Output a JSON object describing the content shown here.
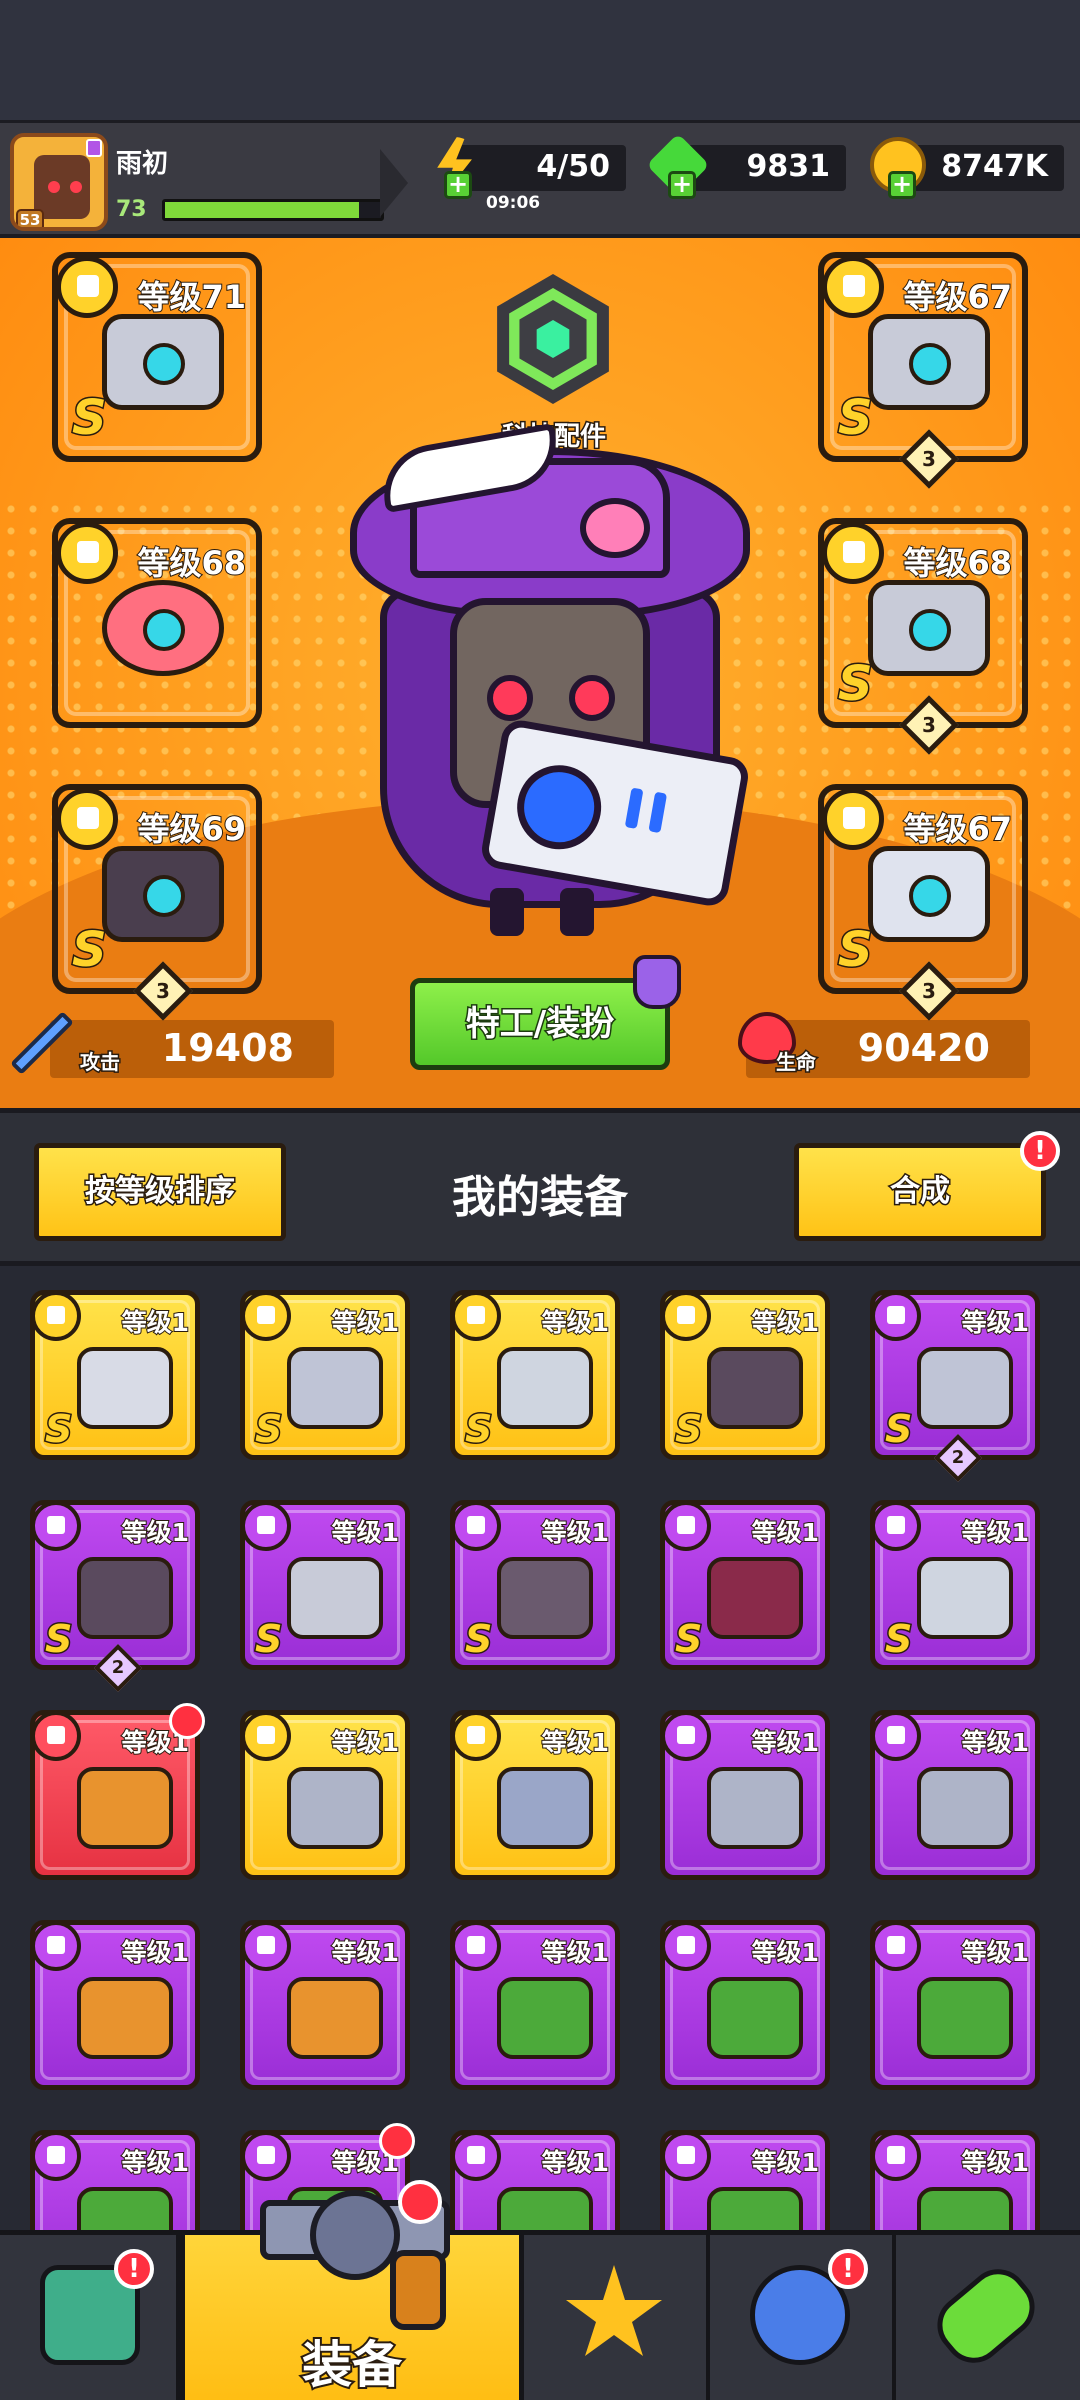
{
  "player": {
    "name": "雨初",
    "level": "73",
    "avatar_level": "53",
    "xp_fraction": 0.9
  },
  "resources": {
    "energy": {
      "value": "4/50",
      "timer": "09:06",
      "icon": "lightning-icon",
      "color": "#ffc21f"
    },
    "gems": {
      "value": "9831",
      "icon": "green-gem-icon",
      "color": "#46d93a"
    },
    "coins": {
      "value": "8747K",
      "icon": "gold-coin-icon",
      "color": "#ffc21f"
    }
  },
  "hero": {
    "tech_part_label": "科技配件",
    "agent_button": "特工/装扮",
    "attack": {
      "label": "攻击",
      "value": "19408"
    },
    "health": {
      "label": "生命",
      "value": "90420"
    },
    "equipped": [
      {
        "slot": "weapon",
        "level": "等级71",
        "grade": "S",
        "rarity": "gold",
        "stars": ""
      },
      {
        "slot": "necklace",
        "level": "等级68",
        "grade": "",
        "rarity": "red",
        "stars": ""
      },
      {
        "slot": "gloves",
        "level": "等级69",
        "grade": "S",
        "rarity": "gold",
        "stars": "3"
      },
      {
        "slot": "armor",
        "level": "等级67",
        "grade": "S",
        "rarity": "gold",
        "stars": "3"
      },
      {
        "slot": "belt",
        "level": "等级68",
        "grade": "S",
        "rarity": "gold",
        "stars": "3"
      },
      {
        "slot": "boots",
        "level": "等级67",
        "grade": "S",
        "rarity": "gold",
        "stars": "3"
      }
    ]
  },
  "toolbar": {
    "sort_button": "按等级排序",
    "title": "我的装备",
    "merge_button": "合成",
    "merge_alert": "!"
  },
  "inventory": [
    {
      "level": "等级1",
      "grade": "S",
      "rarity": "gold",
      "stars": "",
      "art": "#d8dbe6"
    },
    {
      "level": "等级1",
      "grade": "S",
      "rarity": "gold",
      "stars": "",
      "art": "#bfc4d6"
    },
    {
      "level": "等级1",
      "grade": "S",
      "rarity": "gold",
      "stars": "",
      "art": "#cfd5e0"
    },
    {
      "level": "等级1",
      "grade": "S",
      "rarity": "gold",
      "stars": "",
      "art": "#5a4a5e"
    },
    {
      "level": "等级1",
      "grade": "S",
      "rarity": "purple",
      "stars": "2",
      "art": "#bfc4d6"
    },
    {
      "level": "等级1",
      "grade": "S",
      "rarity": "purple",
      "stars": "2",
      "art": "#5a4a5e"
    },
    {
      "level": "等级1",
      "grade": "S",
      "rarity": "purple",
      "stars": "",
      "art": "#c8cbd8"
    },
    {
      "level": "等级1",
      "grade": "S",
      "rarity": "purple",
      "stars": "",
      "art": "#6a5a6e"
    },
    {
      "level": "等级1",
      "grade": "S",
      "rarity": "purple",
      "stars": "",
      "art": "#8a2a4a"
    },
    {
      "level": "等级1",
      "grade": "S",
      "rarity": "purple",
      "stars": "",
      "art": "#cfd5e0"
    },
    {
      "level": "等级1",
      "grade": "",
      "rarity": "red",
      "stars": "",
      "art": "#e8932e",
      "badge": true
    },
    {
      "level": "等级1",
      "grade": "",
      "rarity": "gold",
      "stars": "",
      "art": "#aeb4c8"
    },
    {
      "level": "等级1",
      "grade": "",
      "rarity": "gold",
      "stars": "",
      "art": "#9aa6c8"
    },
    {
      "level": "等级1",
      "grade": "",
      "rarity": "purple",
      "stars": "",
      "art": "#aeb4c8"
    },
    {
      "level": "等级1",
      "grade": "",
      "rarity": "purple",
      "stars": "",
      "art": "#aeb4c8"
    },
    {
      "level": "等级1",
      "grade": "",
      "rarity": "purple",
      "stars": "",
      "art": "#e8932e"
    },
    {
      "level": "等级1",
      "grade": "",
      "rarity": "purple",
      "stars": "",
      "art": "#e8932e"
    },
    {
      "level": "等级1",
      "grade": "",
      "rarity": "purple",
      "stars": "",
      "art": "#4caa3a"
    },
    {
      "level": "等级1",
      "grade": "",
      "rarity": "purple",
      "stars": "",
      "art": "#4caa3a"
    },
    {
      "level": "等级1",
      "grade": "",
      "rarity": "purple",
      "stars": "",
      "art": "#4caa3a"
    },
    {
      "level": "等级1",
      "grade": "",
      "rarity": "purple",
      "stars": "",
      "art": "#4caa3a"
    },
    {
      "level": "等级1",
      "grade": "",
      "rarity": "purple",
      "stars": "",
      "art": "#4caa3a",
      "badge": true
    },
    {
      "level": "等级1",
      "grade": "",
      "rarity": "purple",
      "stars": "",
      "art": "#4caa3a"
    },
    {
      "level": "等级1",
      "grade": "",
      "rarity": "purple",
      "stars": "",
      "art": "#4caa3a"
    },
    {
      "level": "等级1",
      "grade": "",
      "rarity": "purple",
      "stars": "",
      "art": "#4caa3a"
    }
  ],
  "nav": {
    "tabs": [
      {
        "name": "shop",
        "icon": "shop-stall-icon",
        "label": "",
        "alert": "!"
      },
      {
        "name": "equipment",
        "icon": "revolver-icon",
        "label": "装备",
        "alert": ""
      },
      {
        "name": "battle",
        "icon": "crossed-swords-star-icon",
        "label": "",
        "alert": ""
      },
      {
        "name": "events",
        "icon": "planet-icon",
        "label": "",
        "alert": "!"
      },
      {
        "name": "lab",
        "icon": "dna-capsule-icon",
        "label": "",
        "alert": ""
      }
    ]
  }
}
